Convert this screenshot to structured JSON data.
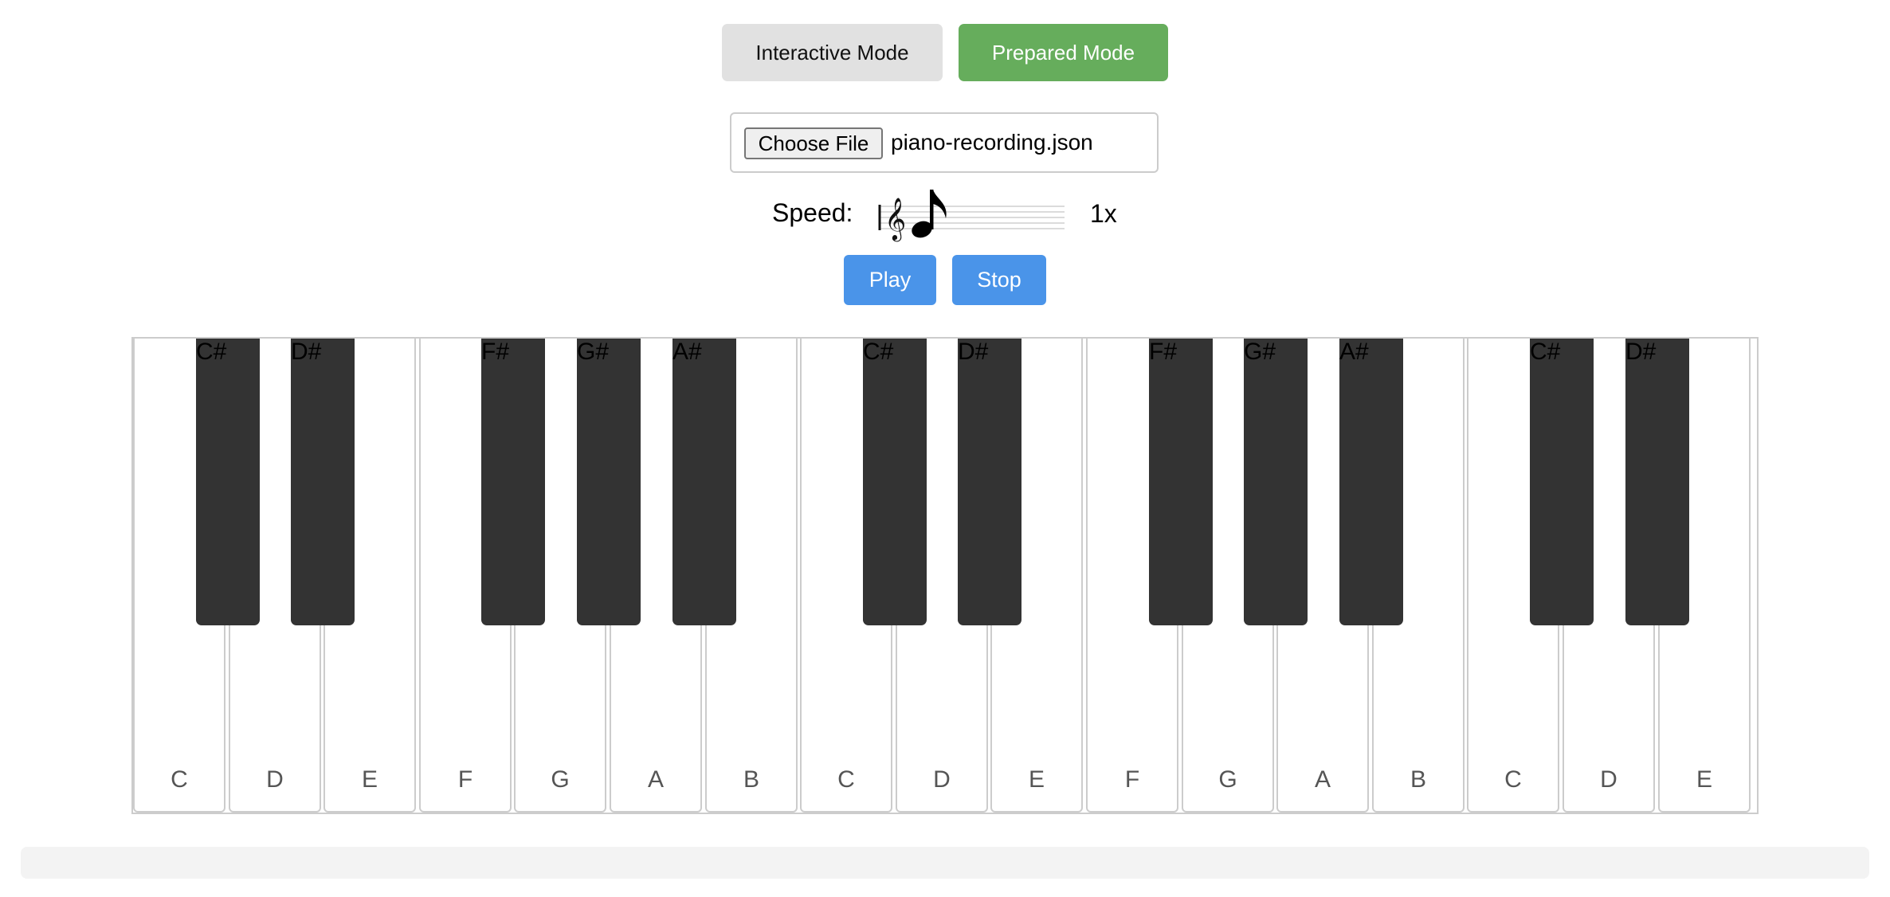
{
  "mode_bar": {
    "interactive_label": "Interactive Mode",
    "prepared_label": "Prepared Mode",
    "active_color": "#66ad5c",
    "inactive_color": "#e1e1e1"
  },
  "file_input": {
    "button_label": "Choose File",
    "file_name": "piano-recording.json"
  },
  "speed": {
    "label": "Speed:",
    "value_text": "1x",
    "level_fraction": 0.3,
    "thumb_icon": "eighth-note-icon",
    "track_icon": "treble-clef-staff-icon"
  },
  "controls": {
    "play_label": "Play",
    "stop_label": "Stop",
    "button_color": "#4a94e9"
  },
  "piano": {
    "white_keys": [
      "C",
      "D",
      "E",
      "F",
      "G",
      "A",
      "B",
      "C",
      "D",
      "E",
      "F",
      "G",
      "A",
      "B",
      "C",
      "D",
      "E"
    ],
    "black_keys": [
      {
        "label": "C#",
        "after_white_index": 0
      },
      {
        "label": "D#",
        "after_white_index": 1
      },
      {
        "label": "F#",
        "after_white_index": 3
      },
      {
        "label": "G#",
        "after_white_index": 4
      },
      {
        "label": "A#",
        "after_white_index": 5
      },
      {
        "label": "C#",
        "after_white_index": 7
      },
      {
        "label": "D#",
        "after_white_index": 8
      },
      {
        "label": "F#",
        "after_white_index": 10
      },
      {
        "label": "G#",
        "after_white_index": 11
      },
      {
        "label": "A#",
        "after_white_index": 12
      },
      {
        "label": "C#",
        "after_white_index": 14
      },
      {
        "label": "D#",
        "after_white_index": 15
      }
    ],
    "black_key_color": "#333333"
  },
  "progress": {
    "fraction": 0
  }
}
